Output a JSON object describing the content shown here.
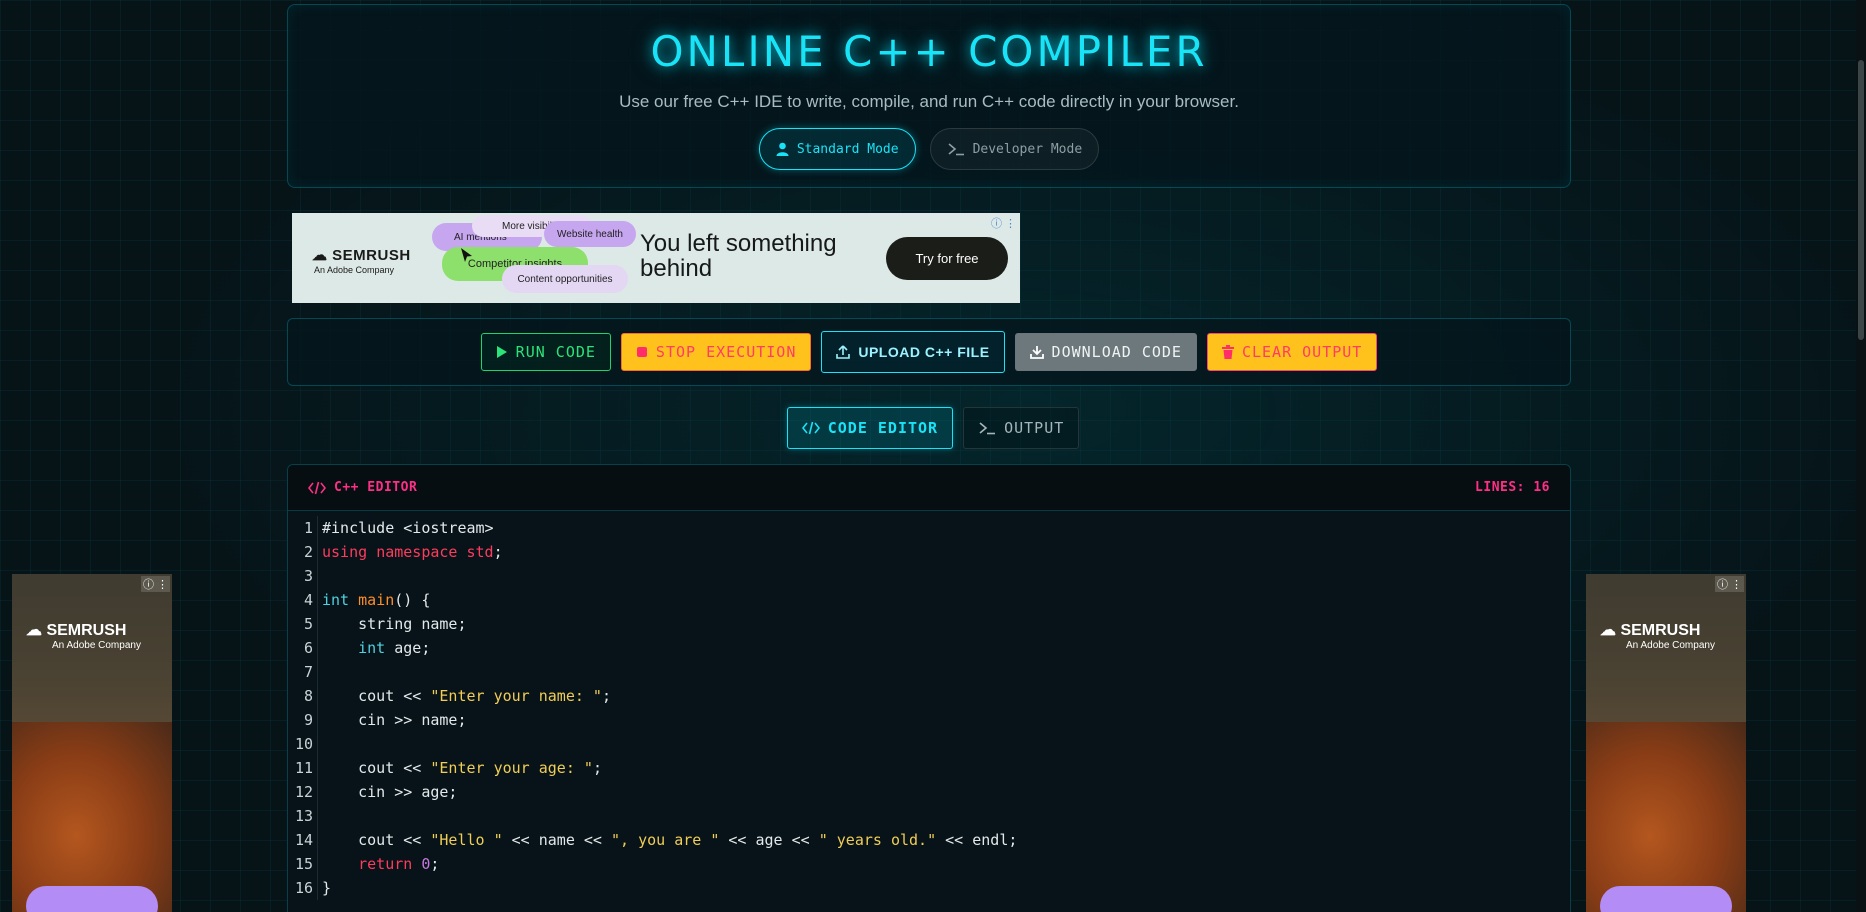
{
  "header": {
    "title": "ONLINE C++ COMPILER",
    "subtitle": "Use our free C++ IDE to write, compile, and run C++ code directly in your browser.",
    "modes": {
      "standard": "Standard Mode",
      "developer": "Developer Mode"
    }
  },
  "ad_banner": {
    "brand": "SEMRUSH",
    "brand_sub": "An Adobe Company",
    "pills": [
      "More visibility",
      "Website health",
      "AI mentions",
      "Competitor insights",
      "Content opportunities"
    ],
    "headline": "You left something behind",
    "cta": "Try for free"
  },
  "toolbar": {
    "run": "RUN CODE",
    "stop": "STOP EXECUTION",
    "upload": "UPLOAD C++ FILE",
    "download": "DOWNLOAD CODE",
    "clear": "CLEAR OUTPUT"
  },
  "tabs": {
    "editor": "CODE EDITOR",
    "output": "OUTPUT"
  },
  "editor": {
    "title": "C++ EDITOR",
    "lines_label": "LINES: 16",
    "line_numbers": [
      "1",
      "2",
      "3",
      "4",
      "5",
      "6",
      "7",
      "8",
      "9",
      "10",
      "11",
      "12",
      "13",
      "14",
      "15",
      "16"
    ],
    "code": [
      "#include <iostream>",
      "using namespace std;",
      "",
      "int main() {",
      "    string name;",
      "    int age;",
      "",
      "    cout << \"Enter your name: \";",
      "    cin >> name;",
      "",
      "    cout << \"Enter your age: \";",
      "    cin >> age;",
      "",
      "    cout << \"Hello \" << name << \", you are \" << age << \" years old.\" << endl;",
      "    return 0;",
      "}"
    ]
  },
  "side_ads": {
    "brand": "SEMRUSH",
    "brand_sub": "An Adobe Company"
  },
  "colors": {
    "accent": "#19e3f7",
    "editor_title": "#ff2e86",
    "run": "#2ce37a",
    "warn_bg": "#ffc21c"
  }
}
